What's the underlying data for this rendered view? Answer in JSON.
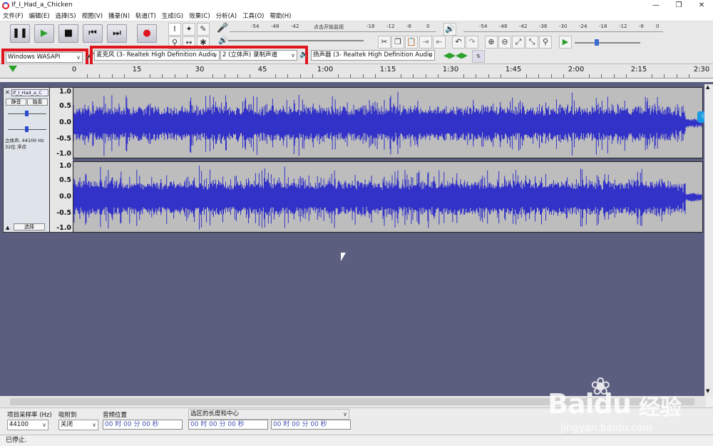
{
  "window": {
    "title": "If_I_Had_a_Chicken"
  },
  "menu": [
    "文件(F)",
    "编辑(E)",
    "选择(S)",
    "视图(V)",
    "播录(N)",
    "轨道(T)",
    "生成(G)",
    "效果(C)",
    "分析(A)",
    "工具(O)",
    "帮助(H)"
  ],
  "toolbar": {
    "record_meter_labels": [
      "-54",
      "-48",
      "-42",
      "点击开始监视",
      "-18",
      "-12",
      "-6",
      "0"
    ],
    "play_meter_labels": [
      "-54",
      "-48",
      "-42",
      "-36",
      "-30",
      "-24",
      "-18",
      "-12",
      "-6",
      "0"
    ],
    "host": "Windows WASAPI",
    "mic": "麦克风 (3- Realtek High Definition Audio",
    "channels": "2 (立体声) 录制声道",
    "speaker": "扬声器 (3- Realtek High Definition Audio"
  },
  "ruler": {
    "labels": [
      "0",
      "15",
      "30",
      "45",
      "1:00",
      "1:15",
      "1:30",
      "1:45",
      "2:00",
      "2:15",
      "2:30"
    ]
  },
  "track": {
    "name": "If_I_Had_a_C",
    "mute": "静音",
    "solo": "独奏",
    "info1": "立体声, 44100 Hz",
    "info2": "32位 浮点",
    "select": "选择",
    "scale": [
      "1.0",
      "0.5",
      "0.0",
      "-0.5",
      "-1.0"
    ]
  },
  "bottom": {
    "rate_label": "项目采样率 (Hz)",
    "rate_value": "44100",
    "snap_label": "吸附到",
    "snap_value": "关闭",
    "pos_label": "音频位置",
    "pos_value": "00 时 00 分 00 秒",
    "sel_label": "选区的长度和中心",
    "sel_start": "00 时 00 分 00 秒",
    "sel_end": "00 时 00 分 00 秒"
  },
  "status": "已停止.",
  "watermark": {
    "brand": "Bai",
    "brand2": "du",
    "cn": "经验",
    "url": "jingyan.baidu.com"
  },
  "colors": {
    "wave": "#3232c8",
    "highlight": "#e0161e",
    "background": "#5c5e80"
  }
}
